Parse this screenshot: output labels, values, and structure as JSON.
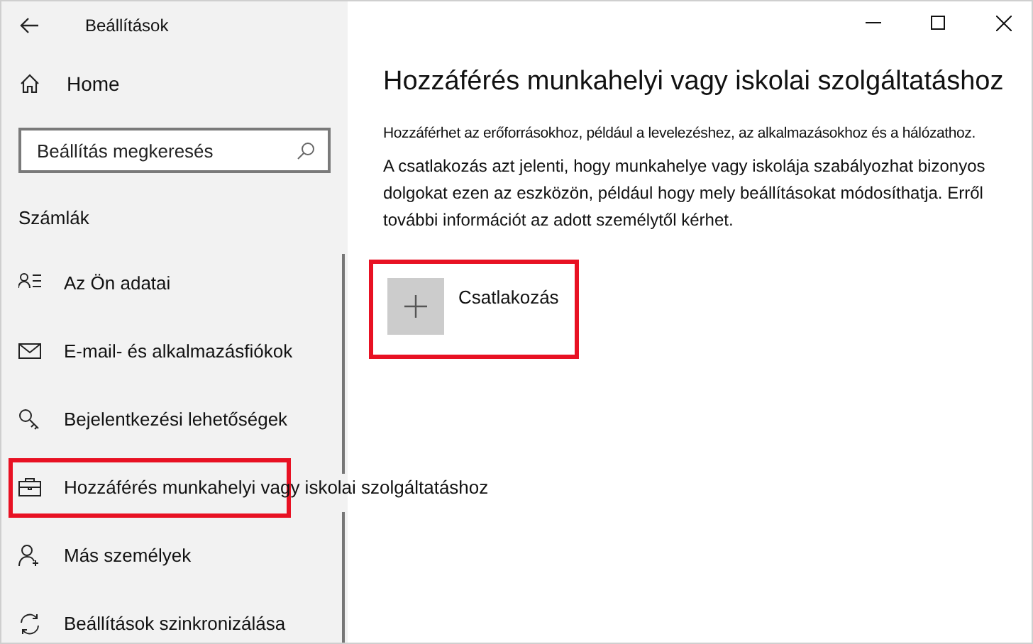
{
  "window": {
    "title": "Beállítások"
  },
  "sidebar": {
    "home": "Home",
    "search": {
      "placeholder": "Beállítás megkeresés"
    },
    "section": "Számlák",
    "items": [
      {
        "kind": "person-list",
        "label": "Az Ön adatai",
        "highlighted": false
      },
      {
        "kind": "mail",
        "label": "E-mail- és alkalmazásfiókok",
        "highlighted": false
      },
      {
        "kind": "key",
        "label": "Bejelentkezési lehetőségek",
        "highlighted": false
      },
      {
        "kind": "briefcase",
        "label": "Hozzáférés munkahelyi vagy iskolai szolgáltatáshoz",
        "highlighted": true
      },
      {
        "kind": "person-add",
        "label": "Más személyek",
        "highlighted": false
      },
      {
        "kind": "sync",
        "label": "Beállítások szinkronizálása",
        "highlighted": false
      }
    ]
  },
  "content": {
    "heading": "Hozzáférés munkahelyi vagy iskolai szolgáltatáshoz",
    "paragraphs": [
      "Hozzáférhet az erőforrásokhoz, például a levelezéshez, az alkalmazásokhoz és a hálózathoz.",
      "A csatlakozás azt jelenti, hogy munkahelye vagy iskolája szabályozhat bizonyos dolgokat ezen az eszközön, például hogy mely beállításokat módosíthatja. Erről további információt az adott személytől kérhet."
    ],
    "join_button": {
      "label": "Csatlakozás",
      "highlighted": true
    }
  }
}
